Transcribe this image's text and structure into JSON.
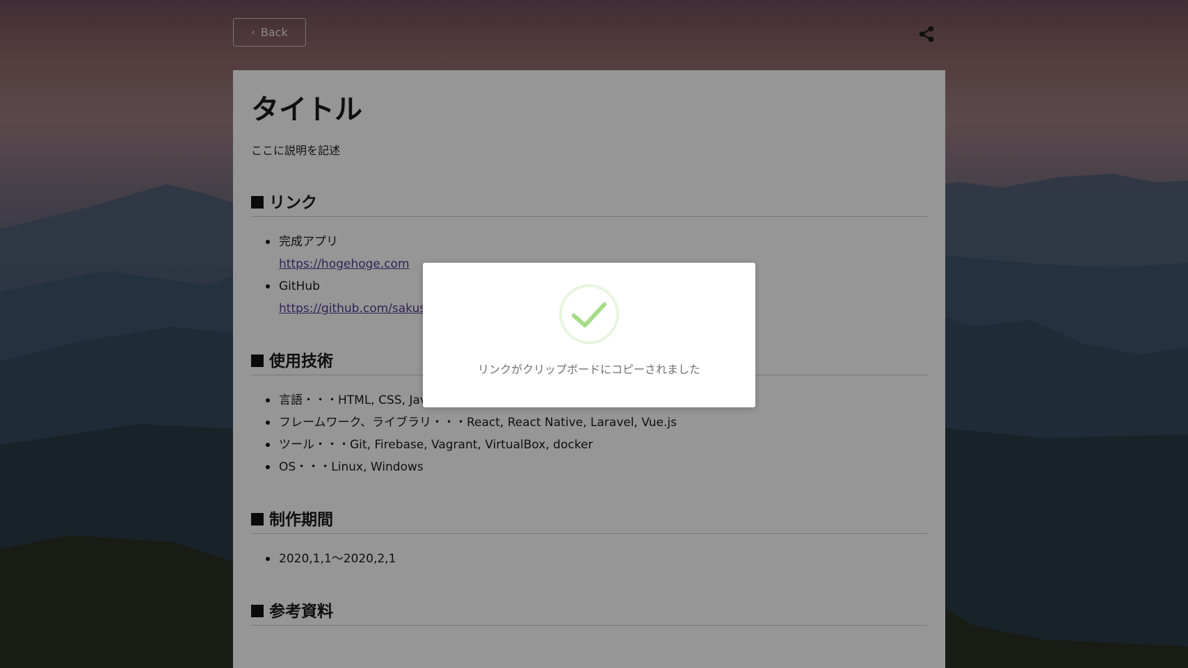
{
  "header": {
    "back_label": "Back",
    "back_icon": "chevron-left-icon",
    "share_icon": "share-icon"
  },
  "article": {
    "title": "タイトル",
    "description": "ここに説明を記述",
    "sections": {
      "links": {
        "heading": "リンク",
        "items": [
          {
            "label": "完成アプリ",
            "url": "https://hogehoge.com"
          },
          {
            "label": "GitHub",
            "url": "https://github.com/sakusak"
          }
        ]
      },
      "tech": {
        "heading": "使用技術",
        "items": [
          "言語・・・HTML, CSS, JavaScript, Node.js, TypeScript, PHP, SQL, Go",
          "フレームワーク、ライブラリ・・・React, React Native, Laravel, Vue.js",
          "ツール・・・Git, Firebase, Vagrant, VirtualBox, docker",
          "OS・・・Linux, Windows"
        ]
      },
      "period": {
        "heading": "制作期間",
        "items": [
          "2020,1,1〜2020,2,1"
        ]
      },
      "references": {
        "heading": "参考資料"
      }
    }
  },
  "dialog": {
    "icon": "success-check-icon",
    "message": "リンクがクリップボードにコピーされました",
    "colors": {
      "check": "#a5dc86",
      "ring": "#e8f5df"
    }
  },
  "colors": {
    "link": "#4c3b8f",
    "card_bg": "#fbfbfb"
  }
}
